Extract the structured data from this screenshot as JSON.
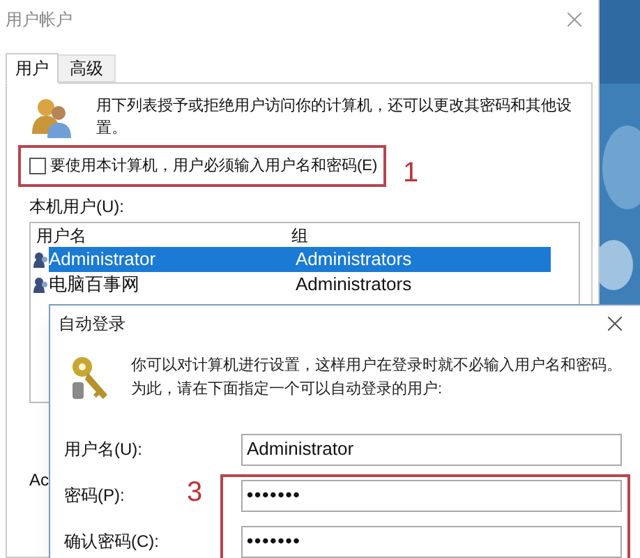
{
  "back_window": {
    "title": "用户帐户",
    "tabs": [
      {
        "label": "用户",
        "selected": true
      },
      {
        "label": "高级",
        "selected": false
      }
    ],
    "description_lines": [
      "用下列表授予或拒绝用户访问你的计算机，还可以更改其密码和其他设",
      "置。"
    ],
    "require_password": {
      "label": "要使用本计算机，用户必须输入用户名和密码(E)",
      "checked": false
    },
    "annotation_1": "1",
    "users_label": "本机用户(U):",
    "users_table": {
      "columns": [
        "用户名",
        "组"
      ],
      "rows": [
        {
          "name": "Administrator",
          "group": "Administrators",
          "selected": true
        },
        {
          "name": "电脑百事网",
          "group": "Administrators",
          "selected": false
        }
      ]
    },
    "partial_label": "Ac"
  },
  "front_dialog": {
    "title": "自动登录",
    "description_lines": [
      "你可以对计算机进行设置，这样用户在登录时就不必输入用户名和密码。",
      "为此，请在下面指定一个可以自动登录的用户:"
    ],
    "fields": [
      {
        "label": "用户名(U):",
        "value": "Administrator"
      },
      {
        "label": "密码(P):",
        "value": "•••••••"
      },
      {
        "label": "确认密码(C):",
        "value": "•••••••"
      }
    ],
    "annotation_3": "3"
  }
}
